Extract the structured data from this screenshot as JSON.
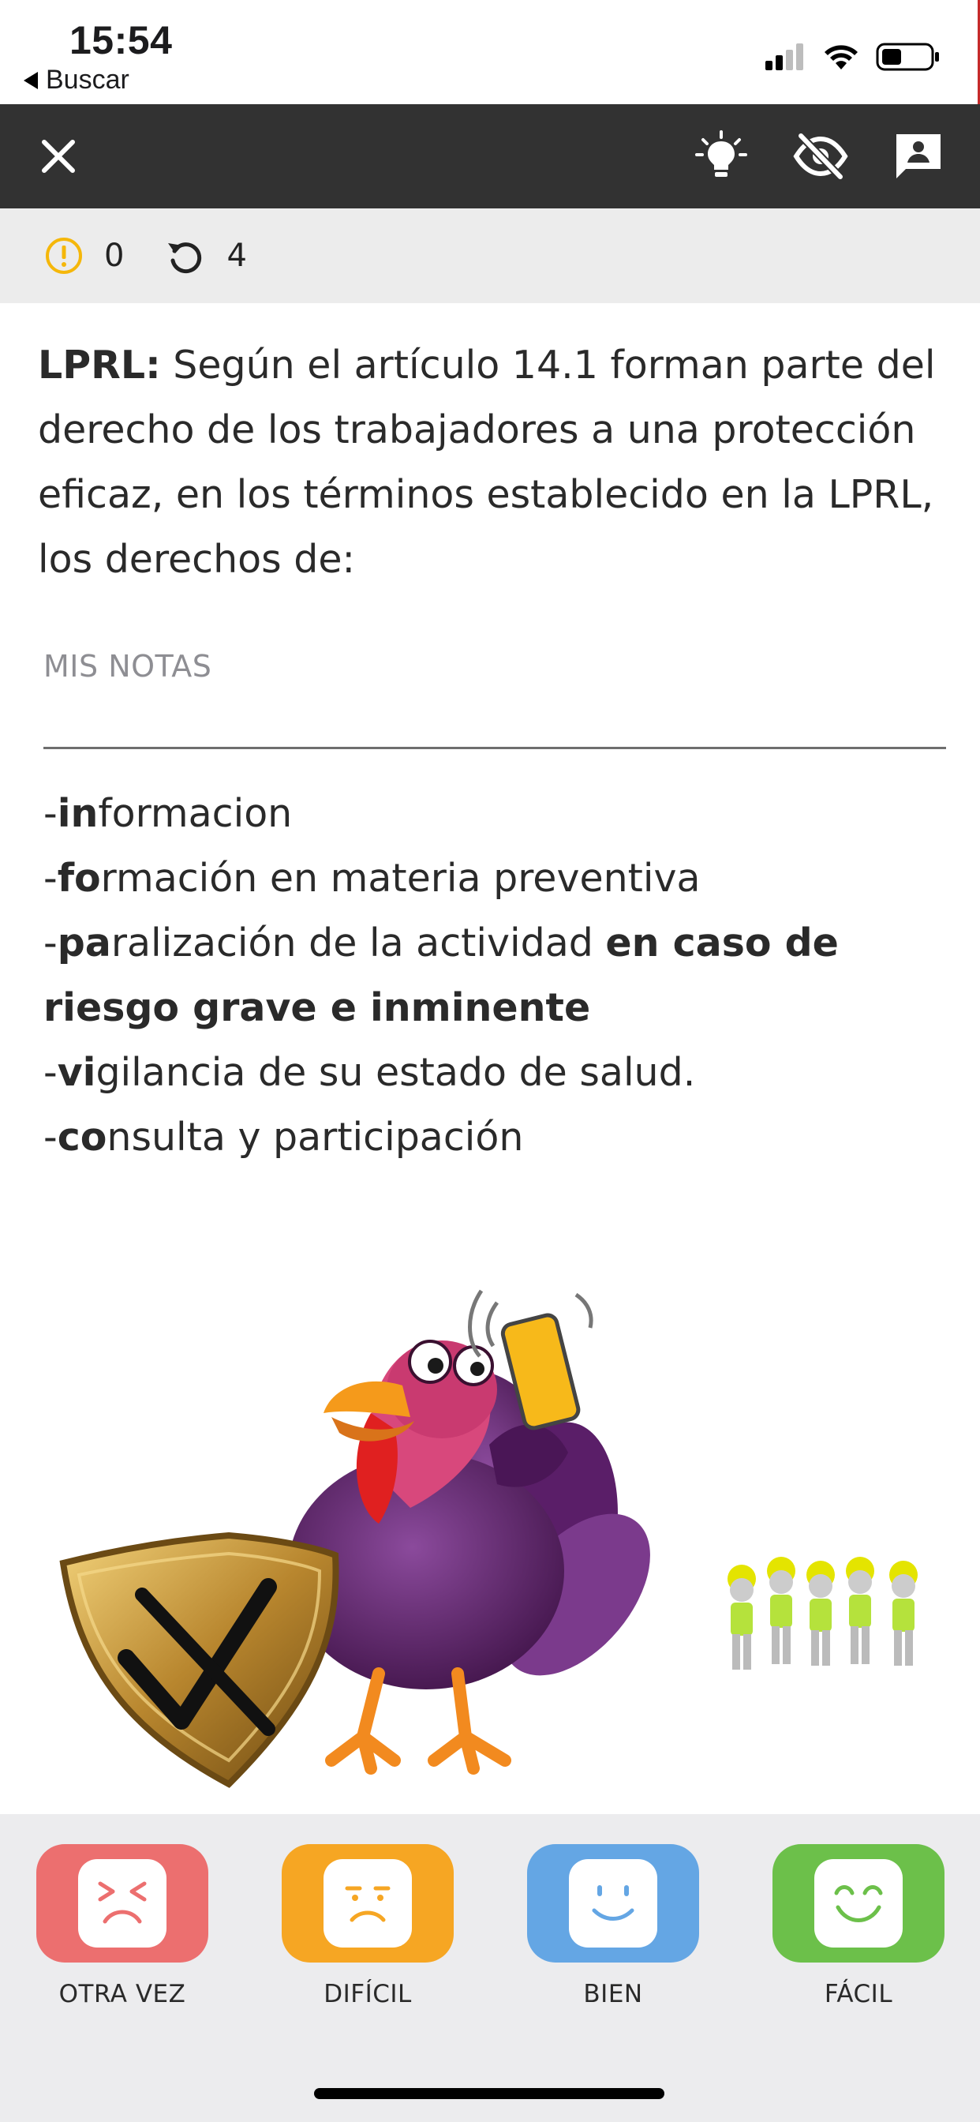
{
  "status_bar": {
    "time": "15:54",
    "back_label": "Buscar"
  },
  "toolbar": {
    "close_icon": "close-icon",
    "hint_icon": "lightbulb-icon",
    "hide_icon": "eye-off-icon",
    "comment_icon": "comment-icon"
  },
  "counters": {
    "errors": "0",
    "repetitions": "4"
  },
  "question": {
    "tag": "LPRL:",
    "text": " Según el artículo 14.1 forman parte del derecho de los trabajadores a una protección eficaz, en los términos establecido en la LPRL, los derechos de:"
  },
  "notes": {
    "label": "MIS NOTAS",
    "items": [
      {
        "prefix": "-",
        "bold": "in",
        "rest": "formacion"
      },
      {
        "prefix": "-",
        "bold": "fo",
        "rest": "rmación en materia preventiva"
      },
      {
        "prefix": "-",
        "bold": "pa",
        "rest": "ralización de la actividad ",
        "bold2": "en caso de riesgo grave e inminente"
      },
      {
        "prefix": "-",
        "bold": "vi",
        "rest": "gilancia de su estado de salud."
      },
      {
        "prefix": "-",
        "bold": "co",
        "rest": "nsulta y participación"
      }
    ]
  },
  "ratings": [
    {
      "label": "OTRA VEZ",
      "color": "#ec6f6f"
    },
    {
      "label": "DIFÍCIL",
      "color": "#f6a623"
    },
    {
      "label": "BIEN",
      "color": "#64a6e4"
    },
    {
      "label": "FÁCIL",
      "color": "#6cc04a"
    }
  ]
}
